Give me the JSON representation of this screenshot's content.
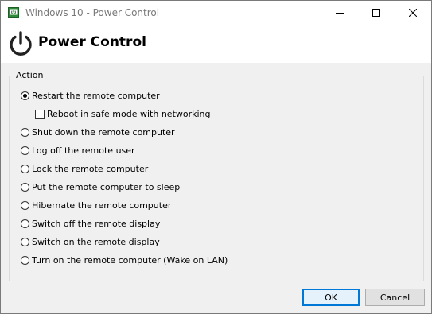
{
  "window": {
    "title": "Windows 10 - Power Control"
  },
  "titlebar_icons": [
    "minimize-icon",
    "maximize-icon",
    "close-icon"
  ],
  "header": {
    "icon": "power-icon",
    "title": "Power Control"
  },
  "action_group": {
    "legend": "Action",
    "options": [
      {
        "label": "Restart the remote computer",
        "type": "radio",
        "checked": true
      },
      {
        "label": "Reboot in safe mode with networking",
        "type": "checkbox",
        "checked": false
      },
      {
        "label": "Shut down the remote computer",
        "type": "radio",
        "checked": false
      },
      {
        "label": "Log off the remote user",
        "type": "radio",
        "checked": false
      },
      {
        "label": "Lock the remote computer",
        "type": "radio",
        "checked": false
      },
      {
        "label": "Put the remote computer to sleep",
        "type": "radio",
        "checked": false
      },
      {
        "label": "Hibernate the remote computer",
        "type": "radio",
        "checked": false
      },
      {
        "label": "Switch off the remote display",
        "type": "radio",
        "checked": false
      },
      {
        "label": "Switch on the remote display",
        "type": "radio",
        "checked": false
      },
      {
        "label": "Turn on the remote computer (Wake on LAN)",
        "type": "radio",
        "checked": false
      }
    ]
  },
  "buttons": {
    "ok_label": "OK",
    "cancel_label": "Cancel"
  },
  "colors": {
    "accent": "#0078d7",
    "app_icon_green": "#2e8b3a"
  }
}
